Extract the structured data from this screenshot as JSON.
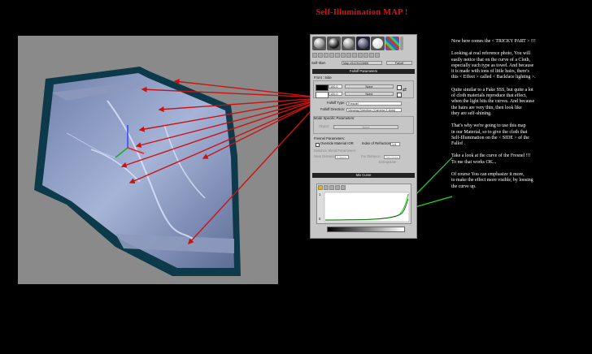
{
  "title": "Self-Illumination MAP !",
  "material_editor": {
    "slot_count": 7,
    "label_selfillum": "Self-Illum",
    "map_name": "Map #1121124666",
    "map_type": "Falloff",
    "rollout_falloff": "Falloff Parameters",
    "front_side": "Front : Side",
    "value1": "100.0",
    "value2": "100.0",
    "none1": "None",
    "none2": "None",
    "falloff_type_label": "Falloff Type:",
    "falloff_type_value": "Fresnel",
    "falloff_dir_label": "Falloff Direction:",
    "falloff_dir_value": "Viewing Direction (Camera Z-Axis)",
    "mode_params": "Mode Specific Parameters:",
    "object_label": "Object:",
    "object_value": "None",
    "fresnel_params": "Fresnel Parameters:",
    "override_ior": "Override Material IOR",
    "ior_label": "Index of Refraction",
    "ior_value": "1.6",
    "distance_blend": "Distance Blend Parameters:",
    "near_label": "Near Distance:",
    "near_value": "0.0mm",
    "far_label": "Far Distance:",
    "far_value": "254.0mm",
    "extrapolate": "Extrapolate",
    "mix_curve": "Mix Curve",
    "curve_top": "1",
    "curve_bottom": "0"
  },
  "notes": [
    "Now here comes the < TRICKY PART >  !!!",
    "Looking at real reference photo, You will\neasily notice that on the curve of a Cloth,\nespecially such type as towel. And because\nit is made with tons of little hairs, there's\nthis < Effect > called < Backface lighting >.",
    "Quite similar to a Fake SSS, but quite a lot\nof cloth materials reproduce that effect,\nwhen the light hits the curves.  And because\nthe hairs are very thin, then look like\nthey are self-shining.",
    "That's why we're going to use this map\nin our Material, so to give the cloth that\nSelf-Illumination on the < SIDE > of the\nFallof .",
    "Take a look at the curve of the Fresnel !!!\nTo me that works OK...",
    "Of course You can emphasize it more,\nto make the effect more visible, by loosing\nthe curve up."
  ],
  "colors": {
    "title": "#dd1111",
    "arrow": "#cc1111",
    "curve": "#22dd22",
    "towel_border": "#0c3a4a"
  }
}
